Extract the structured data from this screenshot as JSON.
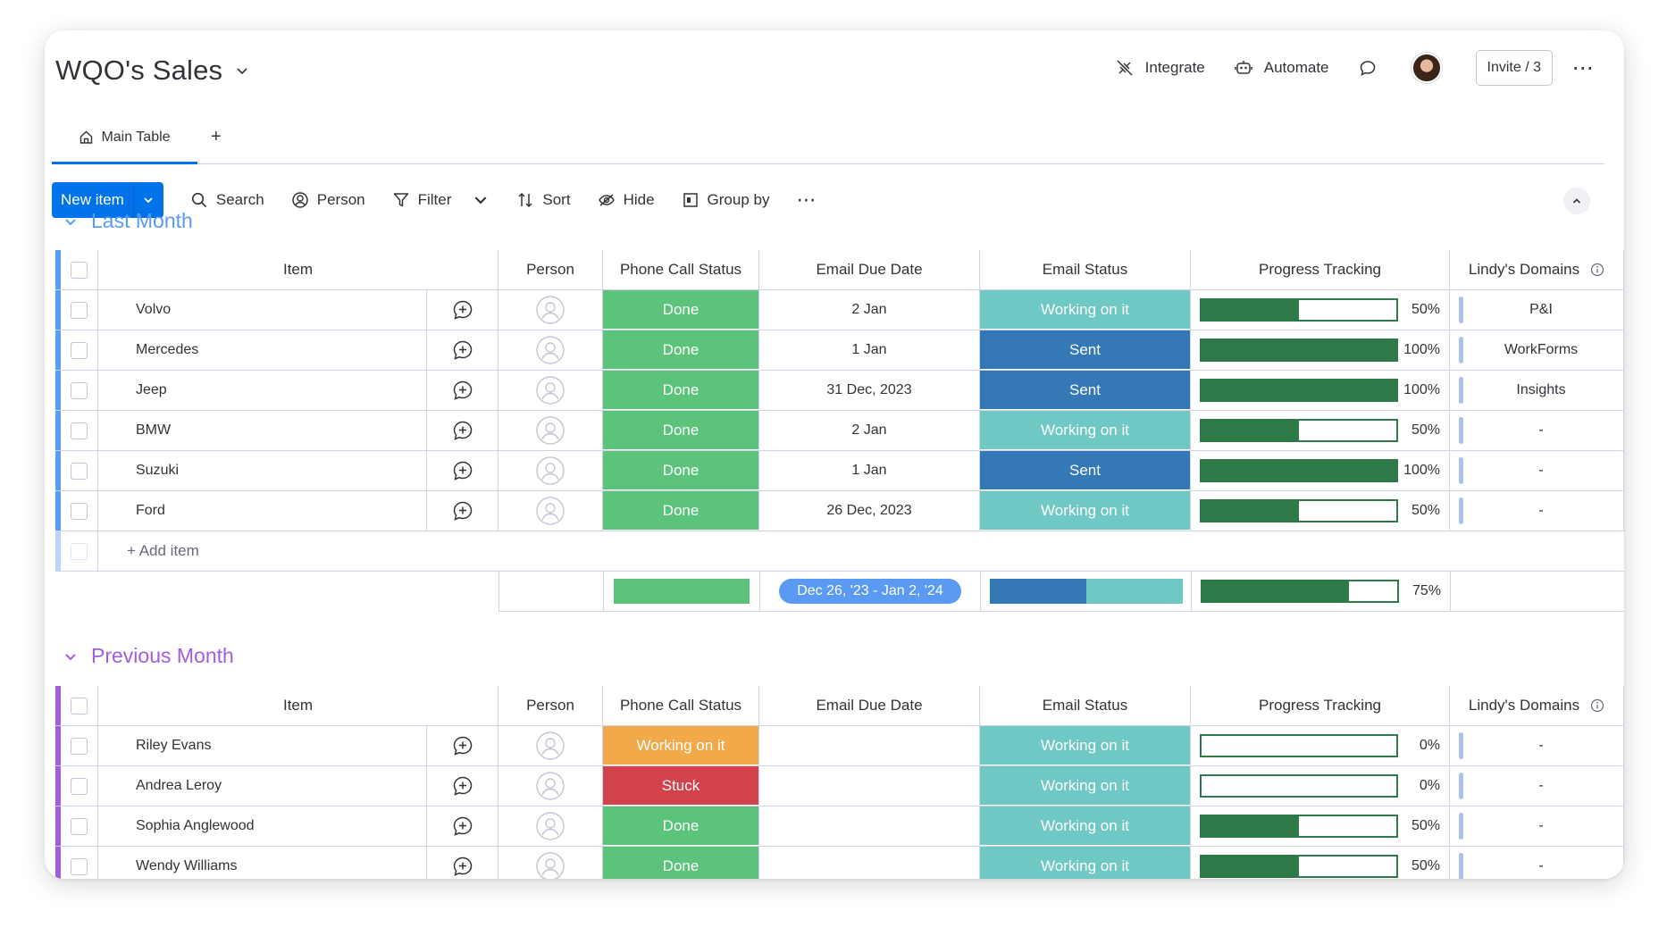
{
  "board": {
    "title": "WQO's Sales",
    "tabs": [
      {
        "label": "Main Table"
      }
    ],
    "tab_add": "+"
  },
  "header": {
    "integrate": "Integrate",
    "automate": "Automate",
    "invite": "Invite / 3"
  },
  "toolbar": {
    "new_item": "New item",
    "search": "Search",
    "person": "Person",
    "filter": "Filter",
    "sort": "Sort",
    "hide": "Hide",
    "group_by": "Group by"
  },
  "columns": {
    "item": "Item",
    "person": "Person",
    "phone_call_status": "Phone Call Status",
    "email_due_date": "Email Due Date",
    "email_status": "Email Status",
    "progress_tracking": "Progress Tracking",
    "domains": "Lindy's Domains"
  },
  "colors": {
    "done": "#5bc37a",
    "working_on_it_phone": "#f1a94a",
    "stuck": "#d1424a",
    "working_on_it_email": "#6fc8c4",
    "sent": "#3478b5",
    "progress": "#2d7a48",
    "group_last_month": "#579bfc",
    "group_previous_month": "#a25ddc"
  },
  "groups": [
    {
      "name": "Last Month",
      "color": "#579bfc",
      "add_item": "+ Add item",
      "summary": {
        "date_range": "Dec 26, '23 - Jan 2, '24",
        "progress": "75%",
        "progress_value": 0.75,
        "email_sent_fraction": 0.5
      },
      "rows": [
        {
          "item": "Volvo",
          "phone": "Done",
          "date": "2 Jan",
          "email": "Working on it",
          "progress": 0.5,
          "progress_label": "50%",
          "domain": "P&I"
        },
        {
          "item": "Mercedes",
          "phone": "Done",
          "date": "1 Jan",
          "email": "Sent",
          "progress": 1.0,
          "progress_label": "100%",
          "domain": "WorkForms"
        },
        {
          "item": "Jeep",
          "phone": "Done",
          "date": "31 Dec, 2023",
          "email": "Sent",
          "progress": 1.0,
          "progress_label": "100%",
          "domain": "Insights"
        },
        {
          "item": "BMW",
          "phone": "Done",
          "date": "2 Jan",
          "email": "Working on it",
          "progress": 0.5,
          "progress_label": "50%",
          "domain": "-"
        },
        {
          "item": "Suzuki",
          "phone": "Done",
          "date": "1 Jan",
          "email": "Sent",
          "progress": 1.0,
          "progress_label": "100%",
          "domain": "-"
        },
        {
          "item": "Ford",
          "phone": "Done",
          "date": "26 Dec, 2023",
          "email": "Working on it",
          "progress": 0.5,
          "progress_label": "50%",
          "domain": "-"
        }
      ]
    },
    {
      "name": "Previous Month",
      "color": "#a25ddc",
      "rows": [
        {
          "item": "Riley Evans",
          "phone": "Working on it",
          "date": "",
          "email": "Working on it",
          "progress": 0.0,
          "progress_label": "0%",
          "domain": "-"
        },
        {
          "item": "Andrea Leroy",
          "phone": "Stuck",
          "date": "",
          "email": "Working on it",
          "progress": 0.0,
          "progress_label": "0%",
          "domain": "-"
        },
        {
          "item": "Sophia Anglewood",
          "phone": "Done",
          "date": "",
          "email": "Working on it",
          "progress": 0.5,
          "progress_label": "50%",
          "domain": "-"
        },
        {
          "item": "Wendy Williams",
          "phone": "Done",
          "date": "",
          "email": "Working on it",
          "progress": 0.5,
          "progress_label": "50%",
          "domain": "-"
        }
      ]
    }
  ]
}
